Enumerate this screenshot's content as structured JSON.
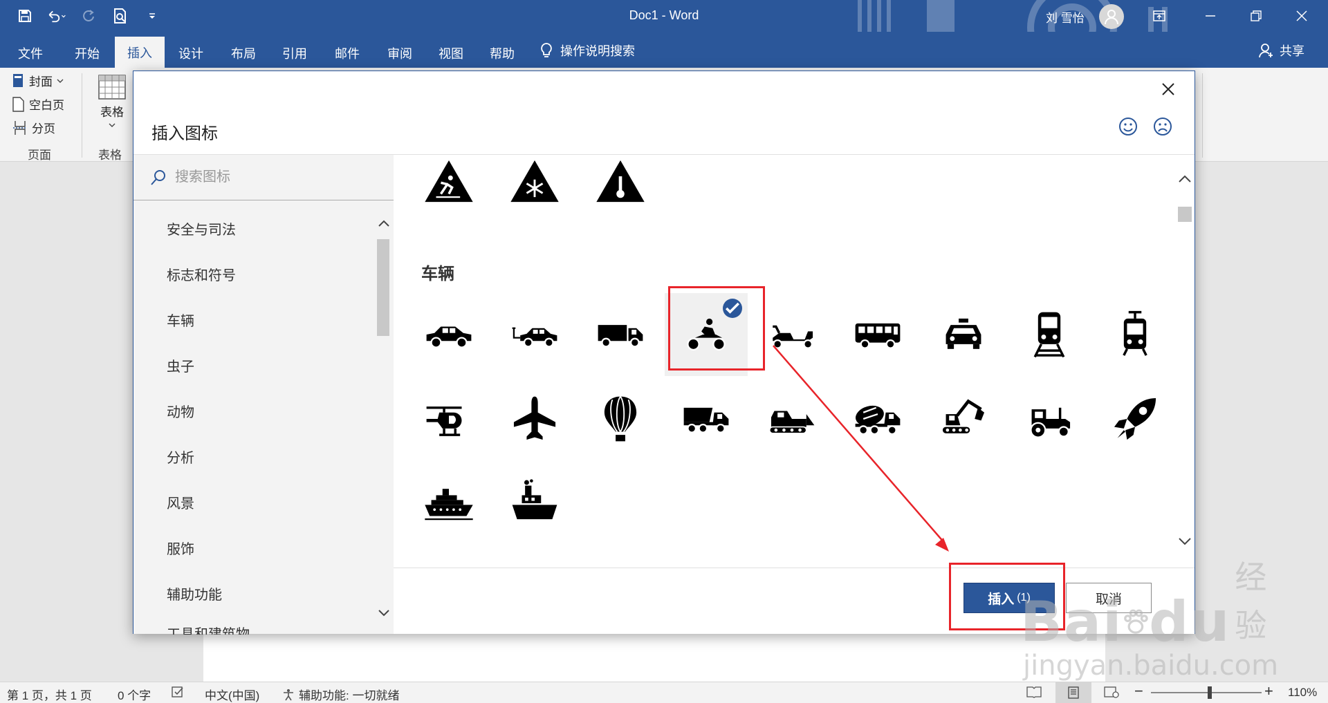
{
  "app": {
    "title": "Doc1  -  Word",
    "user": "刘 雪怡"
  },
  "tabs": [
    {
      "label": "文件",
      "active": false
    },
    {
      "label": "开始",
      "active": false
    },
    {
      "label": "插入",
      "active": true
    },
    {
      "label": "设计",
      "active": false
    },
    {
      "label": "布局",
      "active": false
    },
    {
      "label": "引用",
      "active": false
    },
    {
      "label": "邮件",
      "active": false
    },
    {
      "label": "审阅",
      "active": false
    },
    {
      "label": "视图",
      "active": false
    },
    {
      "label": "帮助",
      "active": false
    }
  ],
  "tell_me": "操作说明搜索",
  "share": "共享",
  "ribbon": {
    "pages": {
      "cover": "封面",
      "blank": "空白页",
      "break": "分页",
      "group": "页面"
    },
    "tables": {
      "table": "表格",
      "group": "表格"
    }
  },
  "dialog": {
    "title": "插入图标",
    "search_placeholder": "搜索图标",
    "categories": [
      "安全与司法",
      "标志和符号",
      "车辆",
      "虫子",
      "动物",
      "分析",
      "风景",
      "服饰",
      "辅助功能",
      "工具和建筑物"
    ],
    "section_title": "车辆",
    "warning_icons": [
      "slippery-floor-warning",
      "snowflake-warning",
      "temperature-warning"
    ],
    "vehicle_icons": [
      "car",
      "electric-car",
      "truck",
      "motorcycle",
      "scooter",
      "bus",
      "taxi",
      "train",
      "tram",
      "helicopter",
      "airplane",
      "hot-air-balloon",
      "dump-truck",
      "bulldozer",
      "cement-mixer",
      "excavator",
      "tractor",
      "rocket",
      "cruise-ship",
      "steamship"
    ],
    "selected_icon": "motorcycle",
    "insert_label": "插入",
    "insert_count": "(1)",
    "cancel_label": "取消"
  },
  "status": {
    "page": "第 1 页，共 1 页",
    "words": "0 个字",
    "language": "中文(中国)",
    "accessibility": "辅助功能: 一切就绪",
    "zoom": "110%"
  },
  "watermark": {
    "brand": "Bai",
    "brand2": "du",
    "suffix": "经验",
    "url": "jingyan.baidu.com"
  },
  "colors": {
    "accent": "#2b579a",
    "highlight": "#e8242a"
  }
}
